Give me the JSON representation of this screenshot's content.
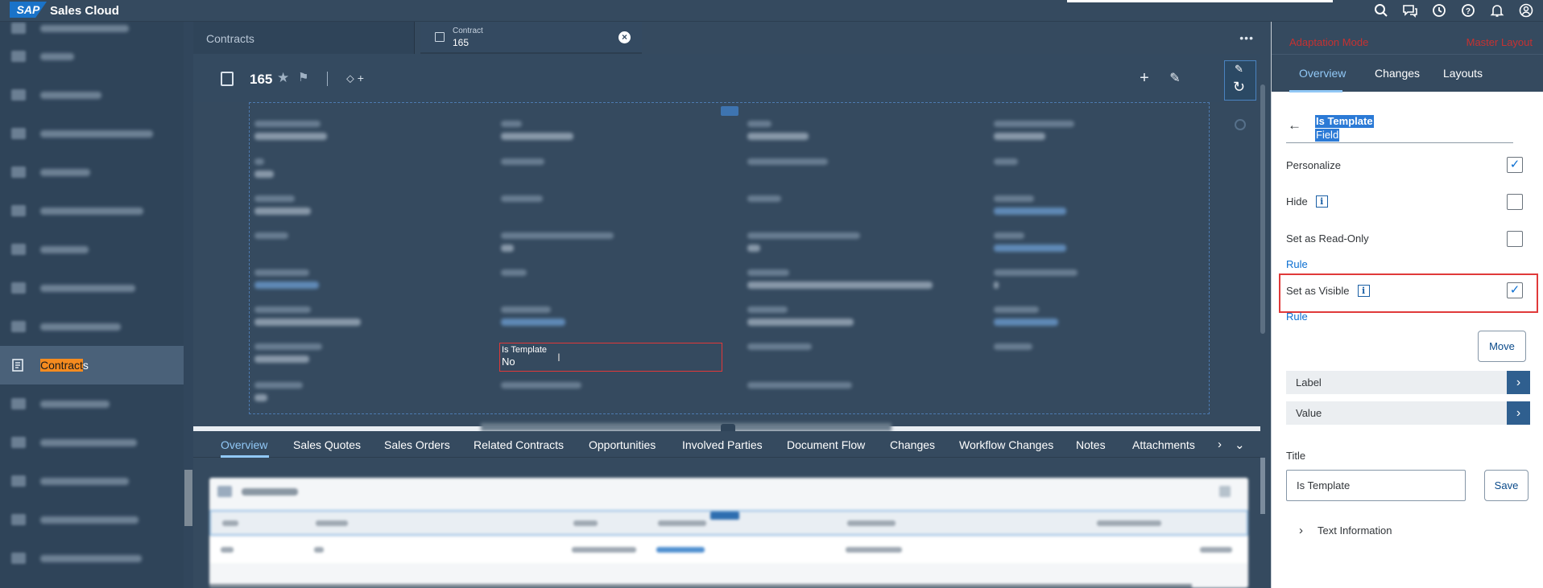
{
  "shell": {
    "logo": "SAP",
    "title": "Sales Cloud",
    "icons": [
      "search-icon",
      "chat-icon",
      "history-icon",
      "help-icon",
      "notifications-icon",
      "user-icon"
    ]
  },
  "leftnav": {
    "active_label_highlight": "Contract",
    "active_label_rest": "s"
  },
  "tabs": {
    "contracts": "Contracts",
    "contract_type": "Contract",
    "contract_id": "165",
    "more": "•••"
  },
  "object_header": {
    "id": "165",
    "tag_plus": "+"
  },
  "highlighted_field": {
    "label": "Is Template",
    "value": "No"
  },
  "facet_tabs": [
    "Overview",
    "Sales Quotes",
    "Sales Orders",
    "Related Contracts",
    "Opportunities",
    "Involved Parties",
    "Document Flow",
    "Changes",
    "Workflow Changes",
    "Notes",
    "Attachments"
  ],
  "adaptation": {
    "mode": "Adaptation Mode",
    "layout": "Master Layout",
    "tabs": [
      "Overview",
      "Changes",
      "Layouts"
    ],
    "selected_tab": "Overview",
    "field_title": "Is Template",
    "field_subtitle": "Field",
    "personalize": "Personalize",
    "personalize_checked": true,
    "hide": "Hide",
    "hide_checked": false,
    "read_only": "Set as Read-Only",
    "read_only_checked": false,
    "rule": "Rule",
    "visible": "Set as Visible",
    "visible_checked": true,
    "move": "Move",
    "label_expander": "Label",
    "value_expander": "Value",
    "title_label": "Title",
    "title_value": "Is Template",
    "save": "Save",
    "text_information": "Text Information"
  },
  "colors": {
    "shell": "#354a5f",
    "accent": "#91c8f6",
    "highlight_border": "#e23838",
    "orange_highlight": "#f58b1f"
  }
}
